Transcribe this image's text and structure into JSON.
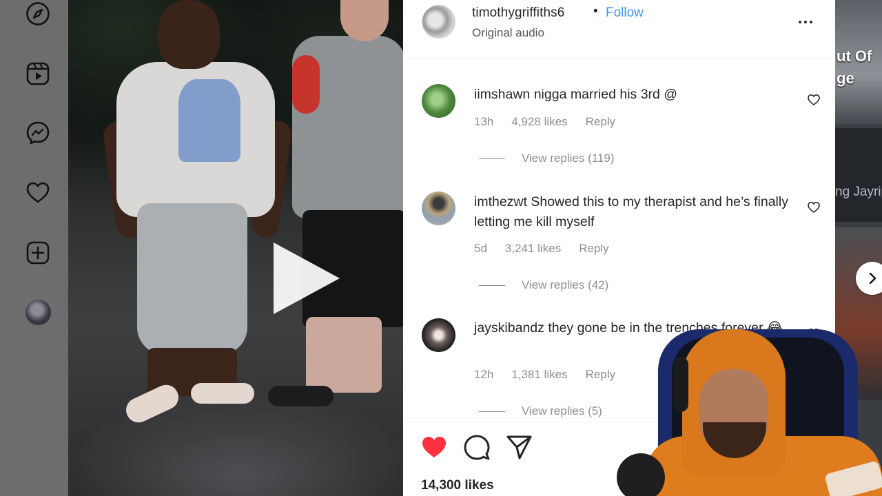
{
  "nav": {
    "items": [
      "explore-icon",
      "reels-icon",
      "messenger-icon",
      "heart-icon",
      "create-icon"
    ]
  },
  "post": {
    "username": "timothygriffiths6",
    "separator": "•",
    "follow_label": "Follow",
    "audio_label": "Original audio",
    "likes_total": "14,300 likes",
    "liked": true
  },
  "comments": [
    {
      "username": "iimshawn",
      "text": "nigga married his 3rd @",
      "time": "13h",
      "likes": "4,928 likes",
      "reply_label": "Reply",
      "view_replies": "View replies (119)"
    },
    {
      "username": "imthezwt",
      "text": "Showed this to my therapist and he’s finally letting me kill myself",
      "time": "5d",
      "likes": "3,241 likes",
      "reply_label": "Reply",
      "view_replies": "View replies (42)"
    },
    {
      "username": "jayskibandz",
      "text": "they gone be in the trenches forever 😂",
      "time": "12h",
      "likes": "1,381 likes",
      "reply_label": "Reply",
      "view_replies": "View replies (5)"
    }
  ],
  "sidebar_thumbs": {
    "top_text": "ut Of\nge",
    "mid_text": "ng Jayrip"
  },
  "colors": {
    "accent": "#3b95f6",
    "heart": "#ff3040",
    "text": "#262626",
    "muted": "#8e8e8e"
  }
}
